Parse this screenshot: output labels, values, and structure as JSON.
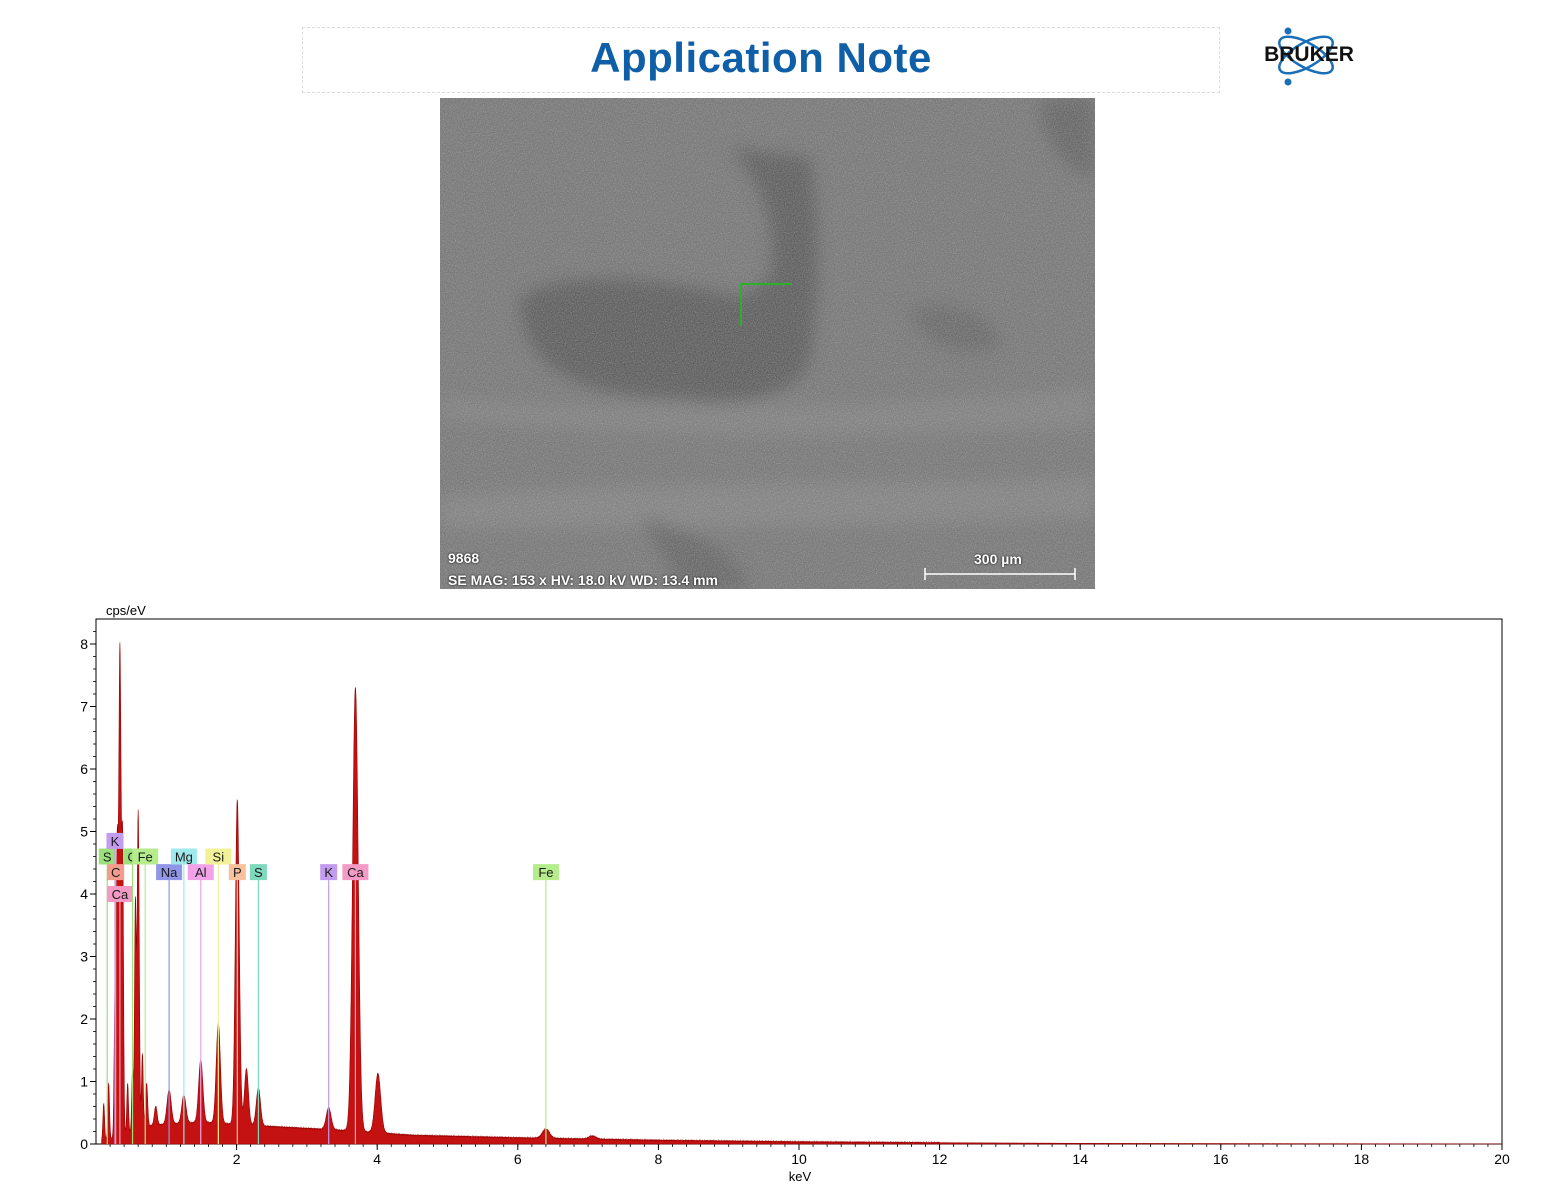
{
  "header": {
    "title": "Application Note",
    "brand": "BRUKER",
    "brand_color": "#0f5fa8"
  },
  "sem_image": {
    "sample_id": "9868",
    "info_line": "SE  MAG: 153 x  HV: 18.0 kV  WD: 13.4 mm",
    "scale_label": "300 µm"
  },
  "chart_data": {
    "type": "line",
    "title": "",
    "xlabel": "keV",
    "ylabel": "cps/eV",
    "xlim": [
      0,
      20
    ],
    "ylim": [
      0,
      8.4
    ],
    "x_ticks": [
      2,
      4,
      6,
      8,
      10,
      12,
      14,
      16,
      18,
      20
    ],
    "y_ticks": [
      0,
      1,
      2,
      3,
      4,
      5,
      6,
      7,
      8
    ],
    "series_color": "#c00000",
    "spectrum_peaks": [
      {
        "x": 0.11,
        "y": 0.6,
        "w": 0.012
      },
      {
        "x": 0.18,
        "y": 0.9,
        "w": 0.012
      },
      {
        "x": 0.27,
        "y": 2.3,
        "w": 0.012
      },
      {
        "x": 0.3,
        "y": 4.1,
        "w": 0.012
      },
      {
        "x": 0.34,
        "y": 7.85,
        "w": 0.018
      },
      {
        "x": 0.38,
        "y": 4.2,
        "w": 0.012
      },
      {
        "x": 0.45,
        "y": 0.8,
        "w": 0.012
      },
      {
        "x": 0.52,
        "y": 1.0,
        "w": 0.012
      },
      {
        "x": 0.56,
        "y": 3.6,
        "w": 0.012
      },
      {
        "x": 0.6,
        "y": 5.1,
        "w": 0.015
      },
      {
        "x": 0.66,
        "y": 1.2,
        "w": 0.012
      },
      {
        "x": 0.72,
        "y": 0.7,
        "w": 0.015
      },
      {
        "x": 0.85,
        "y": 0.3,
        "w": 0.02
      },
      {
        "x": 1.04,
        "y": 0.55,
        "w": 0.03
      },
      {
        "x": 1.25,
        "y": 0.45,
        "w": 0.03
      },
      {
        "x": 1.49,
        "y": 1.0,
        "w": 0.03
      },
      {
        "x": 1.74,
        "y": 1.6,
        "w": 0.03
      },
      {
        "x": 2.01,
        "y": 5.2,
        "w": 0.028
      },
      {
        "x": 2.14,
        "y": 0.9,
        "w": 0.028
      },
      {
        "x": 2.31,
        "y": 0.6,
        "w": 0.03
      },
      {
        "x": 3.31,
        "y": 0.35,
        "w": 0.035
      },
      {
        "x": 3.69,
        "y": 7.1,
        "w": 0.04
      },
      {
        "x": 4.01,
        "y": 0.95,
        "w": 0.04
      },
      {
        "x": 6.4,
        "y": 0.15,
        "w": 0.05
      },
      {
        "x": 7.06,
        "y": 0.05,
        "w": 0.05
      }
    ],
    "background": [
      {
        "x": 0.1,
        "y": 0.05
      },
      {
        "x": 0.8,
        "y": 0.3
      },
      {
        "x": 1.5,
        "y": 0.35
      },
      {
        "x": 2.5,
        "y": 0.28
      },
      {
        "x": 3.5,
        "y": 0.22
      },
      {
        "x": 4.5,
        "y": 0.14
      },
      {
        "x": 6,
        "y": 0.1
      },
      {
        "x": 8,
        "y": 0.06
      },
      {
        "x": 10,
        "y": 0.035
      },
      {
        "x": 12,
        "y": 0.02
      },
      {
        "x": 14,
        "y": 0.01
      },
      {
        "x": 20,
        "y": 0.0
      }
    ],
    "element_lines": [
      {
        "label": "S",
        "x": 0.16,
        "y": 4.6,
        "color": "#9be07a",
        "row": 0
      },
      {
        "label": "K",
        "x": 0.27,
        "y": 4.85,
        "color": "#c39bef",
        "row": -1
      },
      {
        "label": "C",
        "x": 0.28,
        "y": 4.35,
        "color": "#f59a8f",
        "row": 1
      },
      {
        "label": "Ca",
        "x": 0.34,
        "y": 4.0,
        "color": "#f49ac6",
        "row": 2
      },
      {
        "label": "O",
        "x": 0.52,
        "y": 4.6,
        "color": "#9be07a",
        "row": 0
      },
      {
        "label": "Fe",
        "x": 0.7,
        "y": 4.6,
        "color": "#b5ec8c",
        "row": 0
      },
      {
        "label": "Na",
        "x": 1.04,
        "y": 4.35,
        "color": "#8f96e8",
        "row": 1
      },
      {
        "label": "Mg",
        "x": 1.25,
        "y": 4.6,
        "color": "#9fe8ec",
        "row": 0
      },
      {
        "label": "Al",
        "x": 1.49,
        "y": 4.35,
        "color": "#f2a2e8",
        "row": 1
      },
      {
        "label": "Si",
        "x": 1.74,
        "y": 4.6,
        "color": "#f1f19a",
        "row": 0
      },
      {
        "label": "P",
        "x": 2.01,
        "y": 4.35,
        "color": "#f7c19b",
        "row": 1
      },
      {
        "label": "S",
        "x": 2.31,
        "y": 4.35,
        "color": "#7fd9bd",
        "row": 1
      },
      {
        "label": "K",
        "x": 3.31,
        "y": 4.35,
        "color": "#c39bef",
        "row": 1
      },
      {
        "label": "Ca",
        "x": 3.69,
        "y": 4.35,
        "color": "#f49ac6",
        "row": 1
      },
      {
        "label": "Fe",
        "x": 6.4,
        "y": 4.35,
        "color": "#b5ec8c",
        "row": 1
      }
    ]
  }
}
